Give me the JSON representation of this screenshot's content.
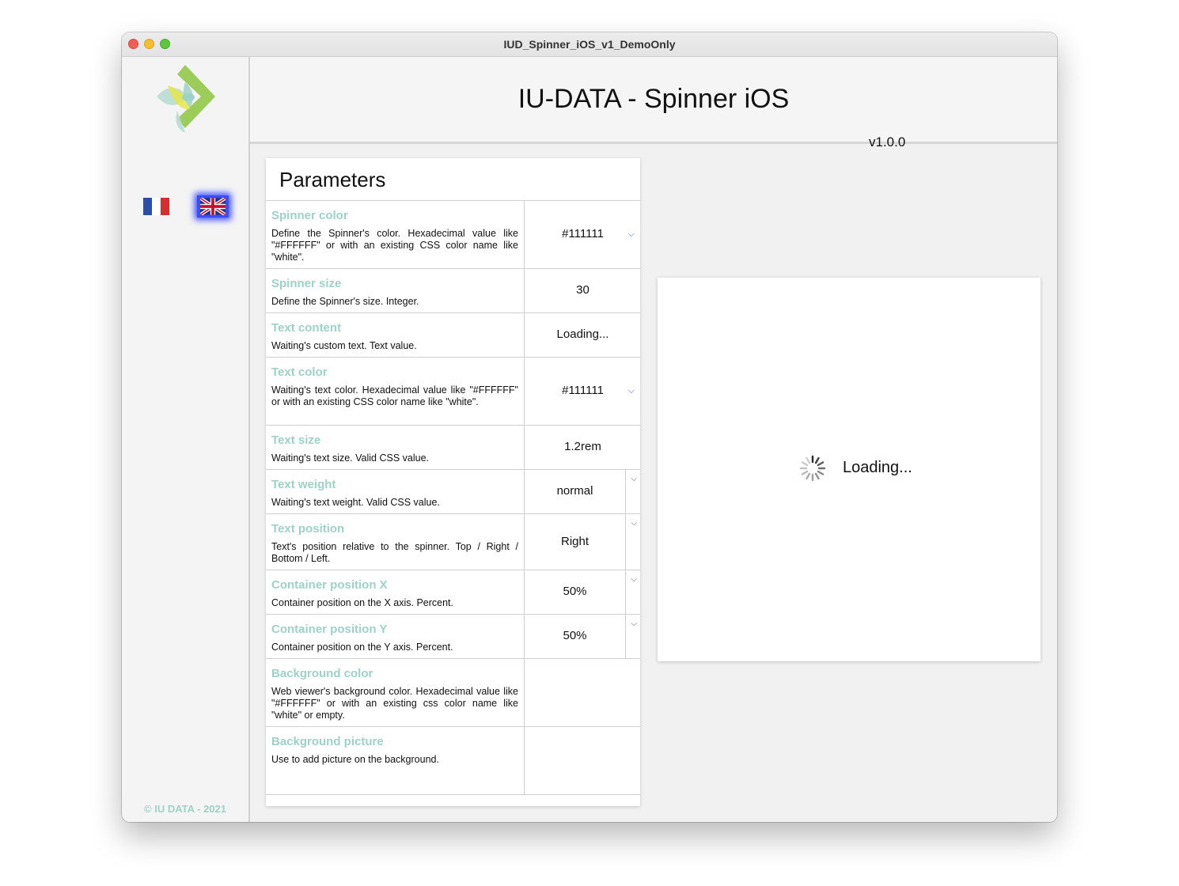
{
  "window": {
    "title": "IUD_Spinner_iOS_v1_DemoOnly"
  },
  "sidebar": {
    "languages": [
      {
        "code": "fr",
        "selected": false
      },
      {
        "code": "en",
        "selected": true
      }
    ],
    "copyright": "© IU DATA - 2021"
  },
  "header": {
    "title": "IU-DATA - Spinner iOS",
    "version": "v1.0.0",
    "info_icon": "info-icon"
  },
  "colors": {
    "accent": "#9dd2c6",
    "selected_flag_glow": "#3b4cff"
  },
  "parameters": {
    "title": "Parameters",
    "rows": [
      {
        "label": "Spinner color",
        "description": "Define the Spinner's color. Hexadecimal value like \"#FFFFFF\" or with an existing CSS color name like \"white\".",
        "value": "#111111"
      },
      {
        "label": "Spinner size",
        "description": "Define the Spinner's size. Integer.",
        "value": "30"
      },
      {
        "label": "Text content",
        "description": "Waiting's custom text. Text value.",
        "value": "Loading..."
      },
      {
        "label": "Text color",
        "description": "Waiting's text color. Hexadecimal value like \"#FFFFFF\" or with an existing CSS color name like \"white\".",
        "value": "#111111"
      },
      {
        "label": "Text size",
        "description": "Waiting's text size. Valid CSS value.",
        "value": "1.2rem"
      },
      {
        "label": "Text weight",
        "description": "Waiting's text weight. Valid CSS value.",
        "value": "normal"
      },
      {
        "label": "Text position",
        "description": "Text's position relative to the spinner. Top / Right / Bottom / Left.",
        "value": "Right"
      },
      {
        "label": "Container position X",
        "description": "Container position on the X axis. Percent.",
        "value": "50%"
      },
      {
        "label": "Container position Y",
        "description": "Container position on the Y axis. Percent.",
        "value": "50%"
      },
      {
        "label": "Background color",
        "description": "Web viewer's background color. Hexadecimal value like \"#FFFFFF\" or with an existing css color name like \"white\" or empty.",
        "value": ""
      },
      {
        "label": "Background picture",
        "description": "Use to add picture on the background.",
        "value": ""
      }
    ]
  },
  "preview": {
    "loading_text": "Loading..."
  }
}
